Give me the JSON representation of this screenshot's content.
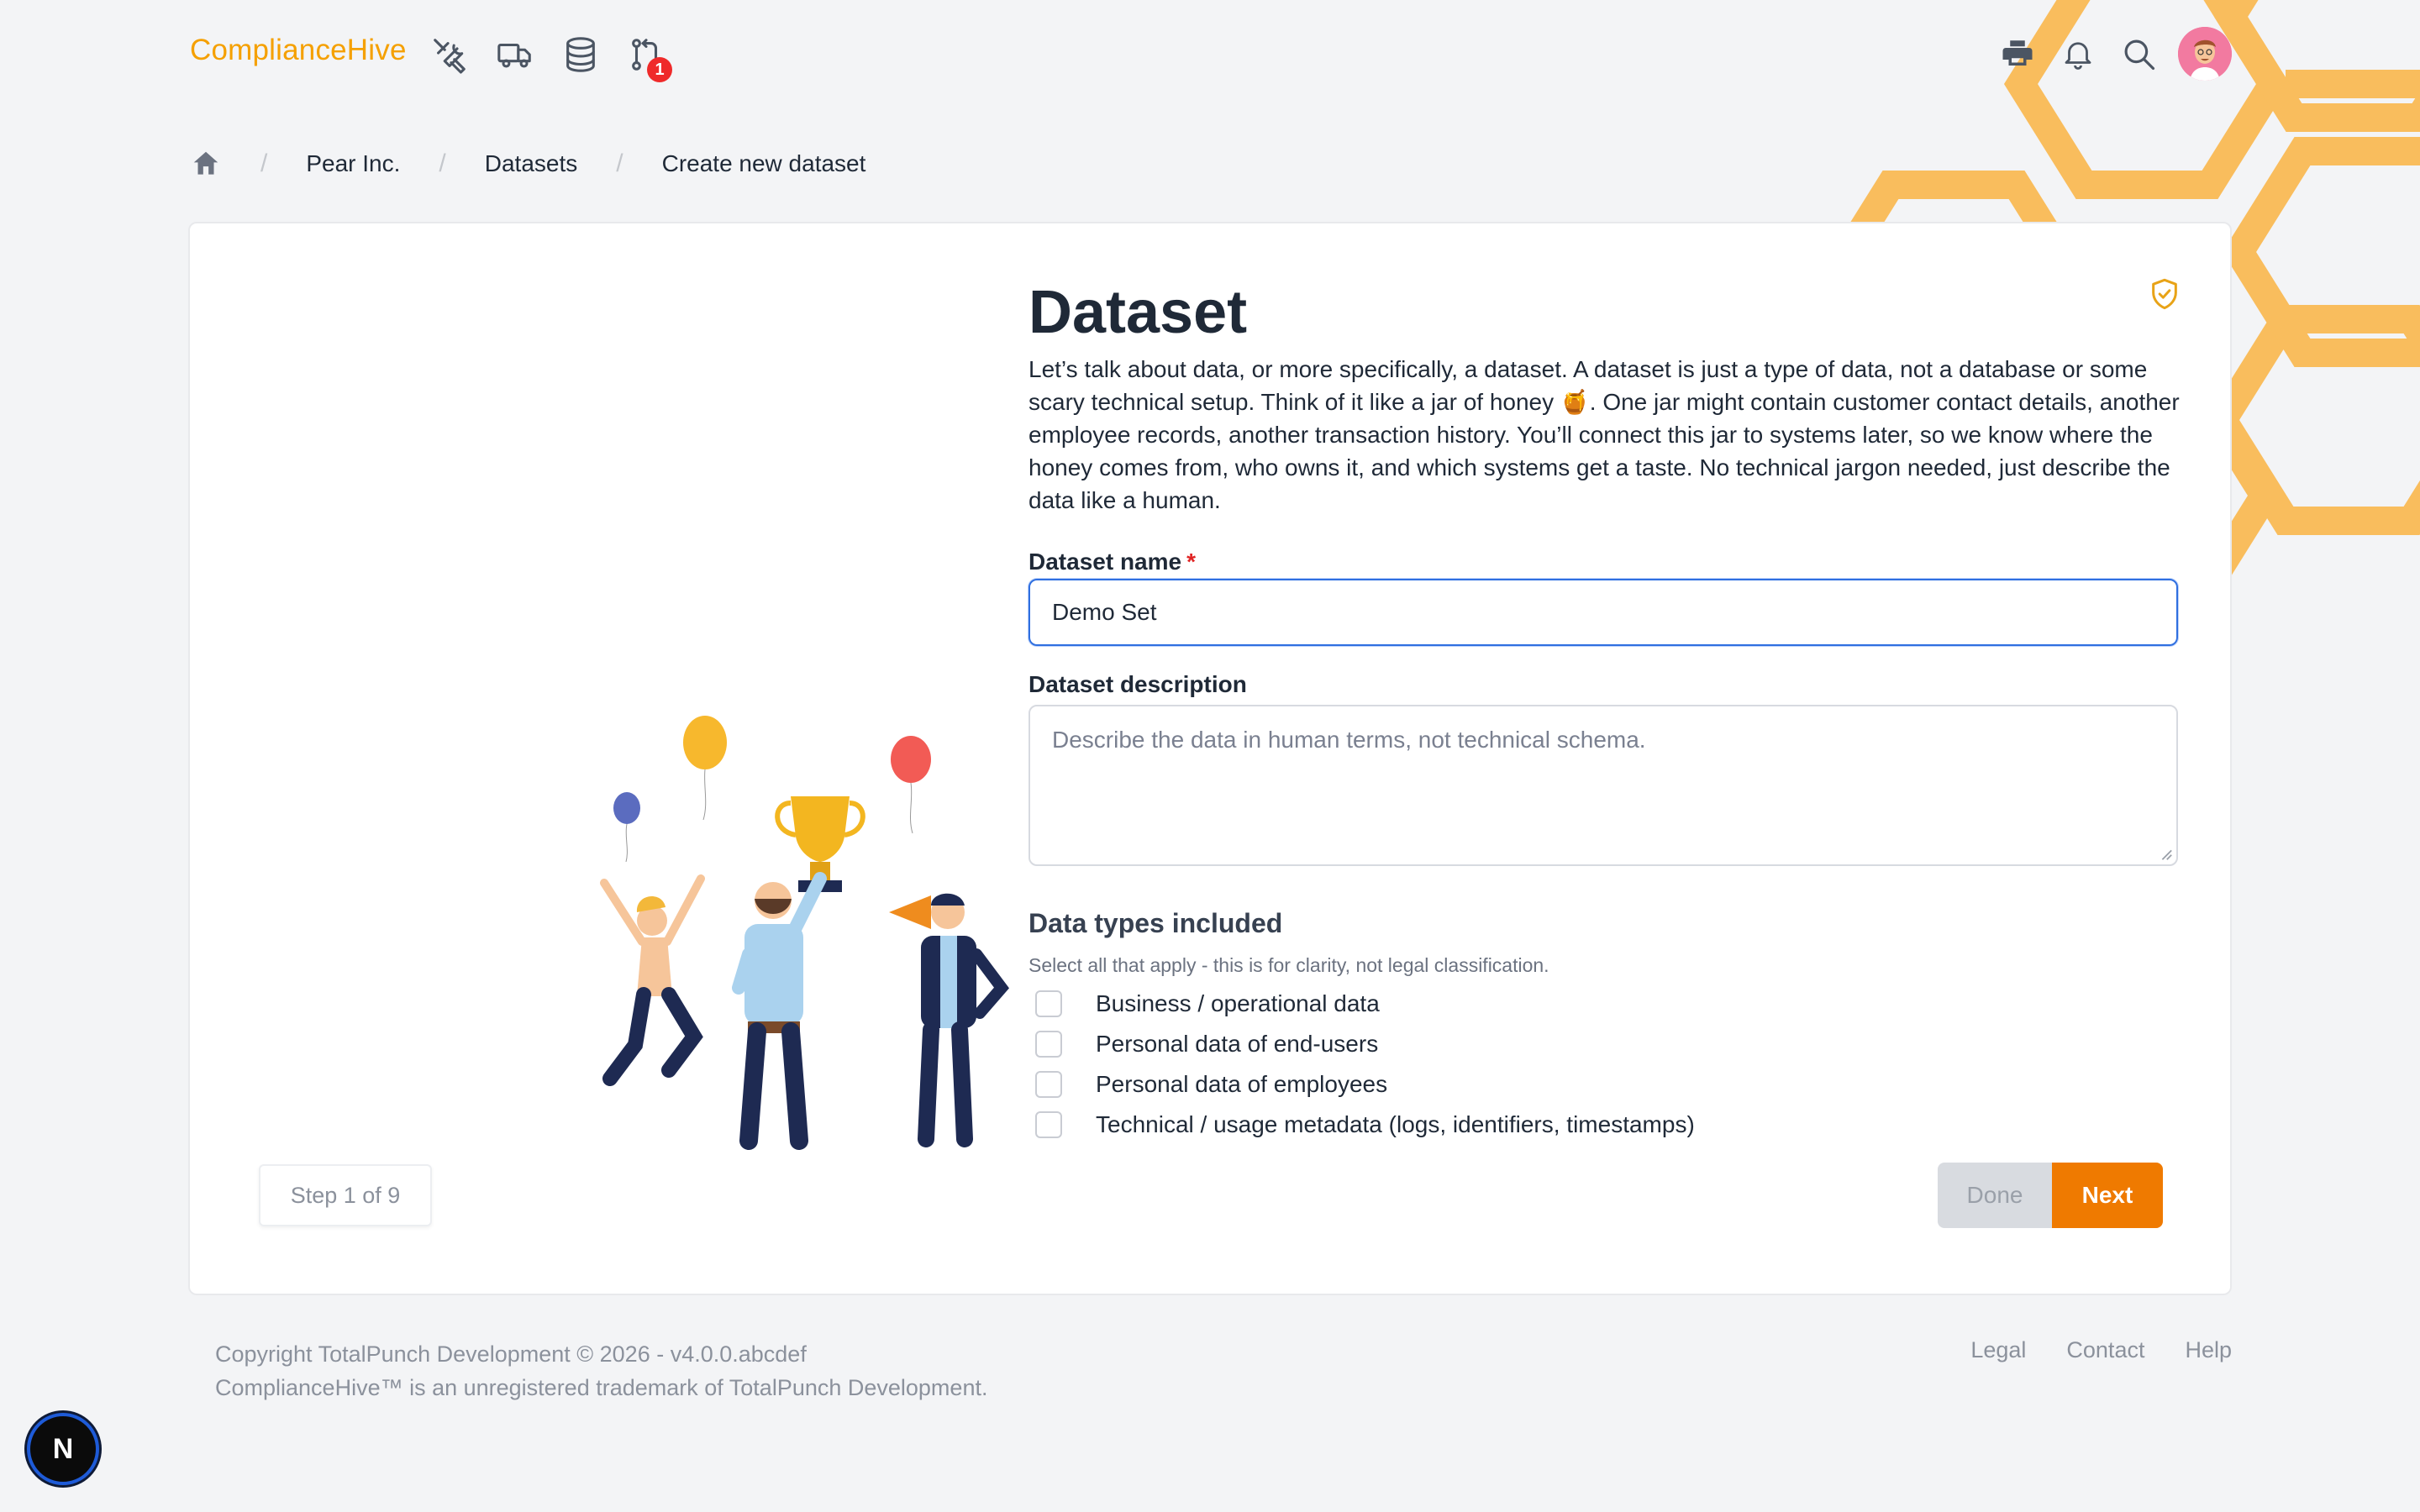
{
  "app": {
    "logo_text": "ComplianceHive",
    "brand_color": "#f5a000"
  },
  "header": {
    "nav_icons": [
      "tools-icon",
      "truck-icon",
      "database-icon",
      "git-pull-request-icon"
    ],
    "notification_badge": "1",
    "right_icons": [
      "printer-icon",
      "bell-icon",
      "search-icon",
      "avatar"
    ]
  },
  "breadcrumb": {
    "items": [
      "Pear Inc.",
      "Datasets",
      "Create new dataset"
    ]
  },
  "form": {
    "title": "Dataset",
    "intro": "Let’s talk about data, or more specifically, a dataset. A dataset is just a type of data, not a database or some scary technical setup. Think of it like a jar of honey 🍯. One jar might contain customer contact details, another employee records, another transaction history. You’ll connect this jar to systems later, so we know where the honey comes from, who owns it, and which systems get a taste. No technical jargon needed, just describe the data like a human.",
    "name_label": "Dataset name",
    "required_mark": "*",
    "name_value": "Demo Set",
    "description_label": "Dataset description",
    "description_placeholder": "Describe the data in human terms, not technical schema.",
    "data_types_title": "Data types included",
    "data_types_hint": "Select all that apply - this is for clarity, not legal classification.",
    "data_types": [
      "Business / operational data",
      "Personal data of end-users",
      "Personal data of employees",
      "Technical / usage metadata (logs, identifiers, timestamps)"
    ],
    "step": "Step 1 of 9",
    "done_label": "Done",
    "next_label": "Next"
  },
  "footer": {
    "copyright": "Copyright TotalPunch Development © 2026 - v4.0.0.abcdef",
    "trademark": "ComplianceHive™ is an unregistered trademark of TotalPunch Development.",
    "links": [
      "Legal",
      "Contact",
      "Help"
    ]
  },
  "dev_badge": "N"
}
